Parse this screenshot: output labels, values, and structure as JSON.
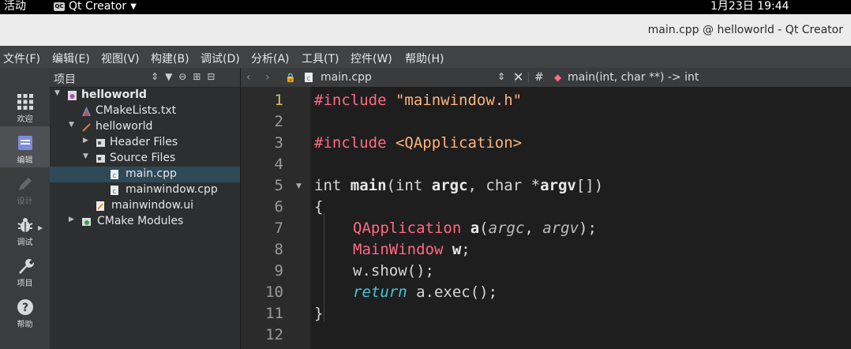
{
  "system_bar": {
    "activities": "活动",
    "app_name": "Qt Creator",
    "app_badge": "QC",
    "clock": "1月23日  19:44"
  },
  "window": {
    "title": "main.cpp @ helloworld - Qt Creator"
  },
  "menu": [
    {
      "label": "文件(F)"
    },
    {
      "label": "编辑(E)"
    },
    {
      "label": "视图(V)"
    },
    {
      "label": "构建(B)"
    },
    {
      "label": "调试(D)"
    },
    {
      "label": "分析(A)"
    },
    {
      "label": "工具(T)"
    },
    {
      "label": "控件(W)"
    },
    {
      "label": "帮助(H)"
    }
  ],
  "modes": [
    {
      "label": "欢迎",
      "icon": "grid-icon"
    },
    {
      "label": "编辑",
      "icon": "edit-document-icon"
    },
    {
      "label": "设计",
      "icon": "pencil-icon"
    },
    {
      "label": "调试",
      "icon": "bug-icon"
    },
    {
      "label": "项目",
      "icon": "wrench-icon"
    },
    {
      "label": "帮助",
      "icon": "help-icon"
    }
  ],
  "project_panel": {
    "title": "项目",
    "tree": [
      {
        "label": "helloworld",
        "level": 0,
        "expanded": true,
        "bold": true,
        "icon": "project-icon"
      },
      {
        "label": "CMakeLists.txt",
        "level": 1,
        "icon": "cmake-icon"
      },
      {
        "label": "helloworld",
        "level": 1,
        "expanded": true,
        "icon": "target-icon"
      },
      {
        "label": "Header Files",
        "level": 2,
        "expanded": false,
        "icon": "folder-h-icon"
      },
      {
        "label": "Source Files",
        "level": 2,
        "expanded": true,
        "icon": "folder-cpp-icon"
      },
      {
        "label": "main.cpp",
        "level": 3,
        "selected": true,
        "icon": "cpp-file-icon"
      },
      {
        "label": "mainwindow.cpp",
        "level": 3,
        "icon": "cpp-file-icon"
      },
      {
        "label": "mainwindow.ui",
        "level": 2,
        "icon": "ui-file-icon"
      },
      {
        "label": "CMake Modules",
        "level": 1,
        "expanded": false,
        "icon": "cmake-modules-icon"
      }
    ]
  },
  "editor": {
    "file_name": "main.cpp",
    "hash": "#",
    "symbol": "main(int, char **) -> int",
    "current_line": 1,
    "lines": [
      "1",
      "2",
      "3",
      "4",
      "5",
      "6",
      "7",
      "8",
      "9",
      "10",
      "11",
      "12"
    ]
  },
  "code_tokens": {
    "l1_pp": "#include ",
    "l1_str": "\"mainwindow.h\"",
    "l3_pp": "#include ",
    "l3_str": "<QApplication>",
    "l5_int": "int ",
    "l5_main": "main",
    "l5_a": "(",
    "l5_int2": "int ",
    "l5_argc": "argc",
    "l5_b": ", ",
    "l5_char": "char ",
    "l5_star": "*",
    "l5_argv": "argv",
    "l5_c": "[])",
    "l6": "{",
    "l7_ty": "QApplication ",
    "l7_a": "a",
    "l7_p": "(",
    "l7_argc": "argc",
    "l7_c": ", ",
    "l7_argv": "argv",
    "l7_e": ");",
    "l8_ty": "MainWindow ",
    "l8_w": "w",
    "l8_e": ";",
    "l9": "w.show();",
    "l10_ret": "return ",
    "l10_rest": "a.exec();",
    "l11": "}"
  }
}
